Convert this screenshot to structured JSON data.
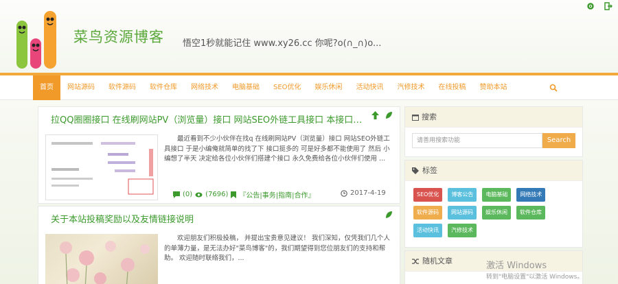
{
  "header": {
    "title": "菜鸟资源博客",
    "description": "悟空1秒就能记住 www.xy26.cc 你呢?o(∩_∩)o..."
  },
  "nav": {
    "items": [
      "首页",
      "网站源码",
      "软件源码",
      "软件仓库",
      "网络技术",
      "电脑基础",
      "SEO优化",
      "娱乐休闲",
      "活动快讯",
      "汽修技术",
      "在线投稿",
      "赞助本站"
    ]
  },
  "posts": [
    {
      "title": "拉QQ圈圈接口 在线刷网站PV（浏览量）接口 网站SEO外链工具接口 本接口永久免...",
      "excerpt": "最近看到不少小伙伴在找q 在线刷网站PV（浏览量）接口 网站SEO外链工具接口 于是小编俺就简单的找了下 接口挺多的 可是好多都不能使用了 然后 小编想了半天 决定给各位小伙伴们搭建个接口 永久免费给各位小伙伴们使用 ...",
      "comments": "(0)",
      "views": "(7696)",
      "category": "『公告|事务|指南|合作』",
      "date": "2017-4-19"
    },
    {
      "title": "关于本站投稿奖励以及友情链接说明",
      "excerpt": "欢迎朋友们积极投稿， 并提出宝贵意见建议！ 我们深知，仅凭我们几个人的单薄力量，是无法办好\"菜鸟博客\"的，我们期望得到您位朋友们的支持和帮助。 欢迎随时联络我们，..."
    }
  ],
  "sidebar": {
    "search_title": "搜索",
    "search_placeholder": "请善用搜索功能",
    "search_button": "Search",
    "tags_title": "标签",
    "tags": [
      {
        "label": "SEO优化",
        "color": "#d9534f"
      },
      {
        "label": "博客公告",
        "color": "#5bc0de"
      },
      {
        "label": "电脑基础",
        "color": "#5cb85c"
      },
      {
        "label": "网络技术",
        "color": "#337ab7"
      },
      {
        "label": "软件源码",
        "color": "#f0ad4e"
      },
      {
        "label": "网站源码",
        "color": "#5bc0de"
      },
      {
        "label": "娱乐休闲",
        "color": "#5cb85c"
      },
      {
        "label": "软件仓库",
        "color": "#5cb85c"
      },
      {
        "label": "活动快讯",
        "color": "#5bc0de"
      },
      {
        "label": "汽修技术",
        "color": "#5cb85c"
      }
    ],
    "random_title": "随机文章"
  },
  "watermark": {
    "line1": "激活 Windows",
    "line2": "转到\"电脑设置\"以激活 Windows。"
  },
  "colors": {
    "accent": "#f19a2a",
    "green": "#3c9a2d"
  }
}
